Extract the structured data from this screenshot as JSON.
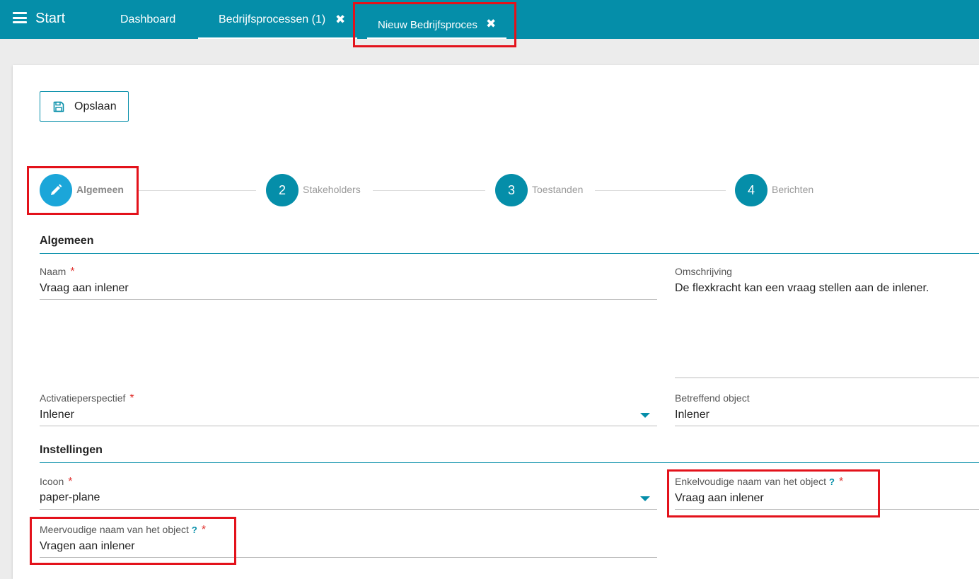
{
  "topbar": {
    "start_label": "Start",
    "tabs": [
      {
        "label": "Dashboard"
      },
      {
        "label": "Bedrijfsprocessen (1)",
        "close": "✖"
      },
      {
        "label": "Nieuw Bedrijfsproces",
        "close": "✖"
      }
    ]
  },
  "toolbar": {
    "save_label": "Opslaan"
  },
  "steps": [
    {
      "number": "",
      "label": "Algemeen",
      "icon": "pencil-icon",
      "active": true
    },
    {
      "number": "2",
      "label": "Stakeholders"
    },
    {
      "number": "3",
      "label": "Toestanden"
    },
    {
      "number": "4",
      "label": "Berichten"
    }
  ],
  "sections": {
    "algemeen": "Algemeen",
    "instellingen": "Instellingen"
  },
  "fields": {
    "naam": {
      "label": "Naam",
      "required": "*",
      "value": "Vraag aan inlener"
    },
    "omschrijving": {
      "label": "Omschrijving",
      "value": "De flexkracht kan een vraag stellen aan de inlener."
    },
    "activatieperspectief": {
      "label": "Activatieperspectief",
      "required": "*",
      "value": "Inlener"
    },
    "betreffend_object": {
      "label": "Betreffend object",
      "value": "Inlener"
    },
    "icoon": {
      "label": "Icoon",
      "required": "*",
      "value": "paper-plane"
    },
    "enkelvoudige_naam": {
      "label": "Enkelvoudige naam van het object",
      "help": "?",
      "required": "*",
      "value": "Vraag aan inlener"
    },
    "meervoudige_naam": {
      "label": "Meervoudige naam van het object",
      "help": "?",
      "required": "*",
      "value": "Vragen aan inlener"
    }
  },
  "colors": {
    "accent": "#058ea9",
    "active_step": "#1ba6d9",
    "required": "#e0302d",
    "highlight": "#e3121b"
  }
}
